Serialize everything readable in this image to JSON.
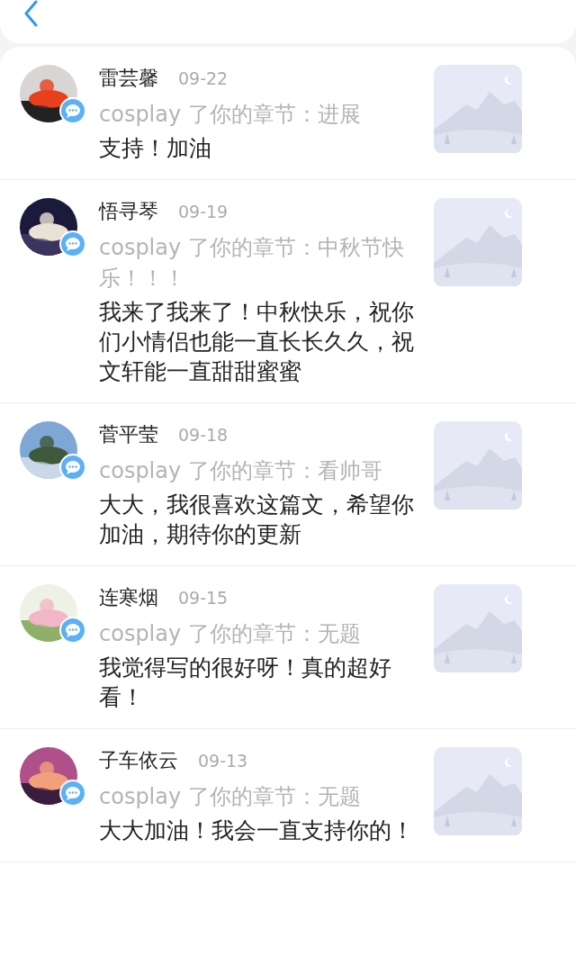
{
  "notifications": [
    {
      "name": "雷芸馨",
      "date": "09-22",
      "action": "cosplay 了你的章节：进展",
      "comment": "支持！加油"
    },
    {
      "name": "悟寻琴",
      "date": "09-19",
      "action": "cosplay 了你的章节：中秋节快乐！！！",
      "comment": "我来了我来了！中秋快乐，祝你们小情侣也能一直长长久久，祝文轩能一直甜甜蜜蜜"
    },
    {
      "name": "菅平莹",
      "date": "09-18",
      "action": "cosplay 了你的章节：看帅哥",
      "comment": "大大，我很喜欢这篇文，希望你加油，期待你的更新"
    },
    {
      "name": "连寒烟",
      "date": "09-15",
      "action": "cosplay 了你的章节：无题",
      "comment": "我觉得写的很好呀！真的超好看！"
    },
    {
      "name": "子车依云",
      "date": "09-13",
      "action": "cosplay 了你的章节：无题",
      "comment": "大大加油！我会一直支持你的！"
    }
  ]
}
